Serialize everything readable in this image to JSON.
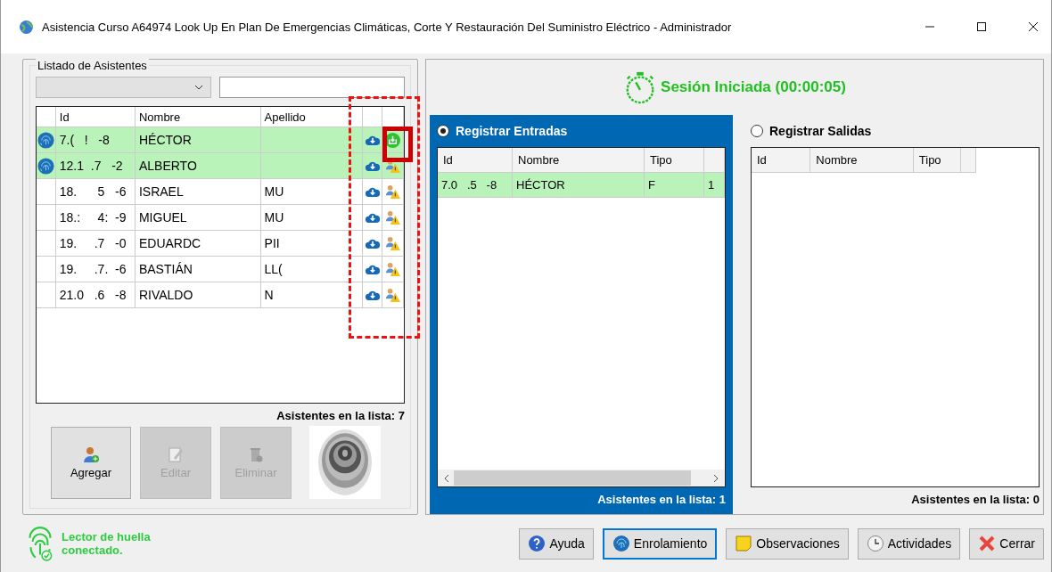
{
  "window": {
    "title": "Asistencia Curso A64974 Look Up En Plan De Emergencias Climáticas, Corte Y Restauración Del Suministro Eléctrico - Administrador"
  },
  "attendees": {
    "group_title": "Listado de Asistentes",
    "columns": [
      "Id",
      "Nombre",
      "Apellido"
    ],
    "rows": [
      {
        "id": "7.(   !   -8",
        "nombre": "HÉCTOR",
        "apellido": "",
        "enrolled": true,
        "registered": true,
        "selected": true
      },
      {
        "id": "12.1  .7   -2",
        "nombre": "ALBERTO",
        "apellido": "",
        "enrolled": true,
        "registered": false,
        "selected": true
      },
      {
        "id": "18.      5   -6",
        "nombre": "ISRAEL",
        "apellido": "MU",
        "enrolled": false,
        "registered": false,
        "selected": false
      },
      {
        "id": "18.:     4:  -9",
        "nombre": "MIGUEL",
        "apellido": "MU",
        "enrolled": false,
        "registered": false,
        "selected": false
      },
      {
        "id": "19.     .7   -0",
        "nombre": "EDUARDC",
        "apellido": "PII",
        "enrolled": false,
        "registered": false,
        "selected": false
      },
      {
        "id": "19.     .7.  -6",
        "nombre": "BASTIÁN",
        "apellido": "LL(",
        "enrolled": false,
        "registered": false,
        "selected": false
      },
      {
        "id": "21.0   .6   -8",
        "nombre": "RIVALDO",
        "apellido": "N",
        "enrolled": false,
        "registered": false,
        "selected": false
      }
    ],
    "count": "Asistentes en la lista: 7",
    "buttons": [
      {
        "label": "Agregar",
        "kind": "add",
        "disabled": false
      },
      {
        "label": "Editar",
        "kind": "edit",
        "disabled": true
      },
      {
        "label": "Eliminar",
        "kind": "delete",
        "disabled": true
      }
    ]
  },
  "reader_status": {
    "text": "Lector de huella conectado.",
    "connected": true
  },
  "session": {
    "text": "Sesión Iniciada (00:00:05)"
  },
  "entries": {
    "label": "Registrar Entradas",
    "selected": true,
    "columns": [
      "Id",
      "Nombre",
      "Tipo"
    ],
    "rows": [
      {
        "id": "7.0   .5   -8",
        "nombre": "HÉCTOR",
        "tipo": "F",
        "column_4": "1"
      }
    ],
    "count": "Asistentes en la lista: 1"
  },
  "exits": {
    "label": "Registrar Salidas",
    "selected": false,
    "columns": [
      "Id",
      "Nombre",
      "Tipo"
    ],
    "count": "Asistentes en la lista: 0"
  },
  "footer_buttons": [
    {
      "label": "Ayuda",
      "kind": "help",
      "selected": false
    },
    {
      "label": "Enrolamiento",
      "kind": "fingerprint",
      "selected": true
    },
    {
      "label": "Observaciones",
      "kind": "note",
      "selected": false
    },
    {
      "label": "Actividades",
      "kind": "clock",
      "selected": false
    },
    {
      "label": "Cerrar",
      "kind": "close",
      "selected": false
    }
  ],
  "annotations": [
    {
      "kind": "dashed-frame"
    },
    {
      "kind": "highlight-box"
    }
  ]
}
